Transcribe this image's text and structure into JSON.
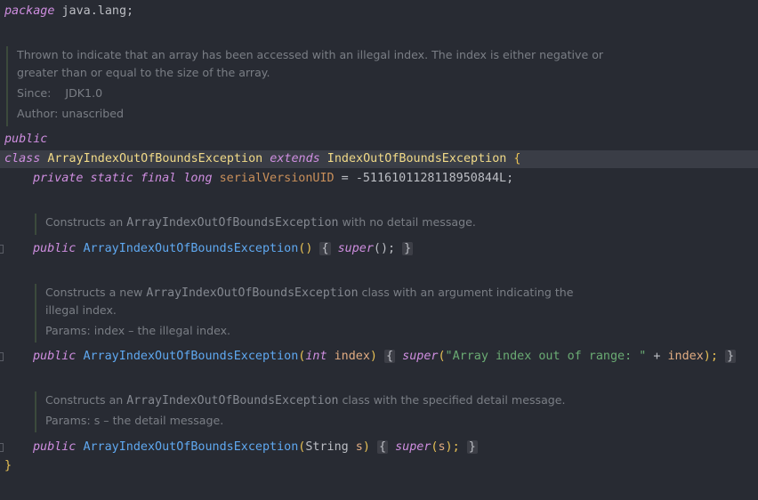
{
  "code": {
    "package_kw": "package",
    "package_name": " java.lang;",
    "class_doc": {
      "line1": "Thrown to indicate that an array has been accessed with an illegal index. The index is either negative or",
      "line2": "greater than or equal to the size of the array.",
      "since_label": "Since:",
      "since_value": "JDK1.0",
      "author": "Author: unascribed"
    },
    "public_kw": "public",
    "class_kw": "class",
    "class_name": "ArrayIndexOutOfBoundsException",
    "extends_kw": "extends",
    "super_class": "IndexOutOfBoundsException",
    "open_brace": "{",
    "field": {
      "private_kw": "private",
      "static_kw": "static",
      "final_kw": "final",
      "long_kw": "long",
      "name": "serialVersionUID",
      "assign": " = ",
      "value": "-5116101128118950844L",
      "semicolon": ";"
    },
    "ctor1_doc": {
      "pre": "Constructs an ",
      "code": "ArrayIndexOutOfBoundsException",
      "post": " with no detail message."
    },
    "ctor1": {
      "public_kw": "public",
      "name": "ArrayIndexOutOfBoundsException",
      "params": "()",
      "open": "{",
      "super_kw": "super",
      "call": "();",
      "close": "}"
    },
    "ctor2_doc": {
      "pre": "Constructs a new ",
      "code": "ArrayIndexOutOfBoundsException",
      "post": " class with an argument indicating the",
      "line2": "illegal index.",
      "params": "Params: index – the illegal index."
    },
    "ctor2": {
      "public_kw": "public",
      "name": "ArrayIndexOutOfBoundsException",
      "paren_open": "(",
      "int_kw": "int",
      "param": "index",
      "paren_close": ")",
      "open": "{",
      "super_kw": "super",
      "call_open": "(",
      "string": "\"Array index out of range: \"",
      "plus": " + ",
      "arg": "index",
      "call_close": ");",
      "close": "}"
    },
    "ctor3_doc": {
      "pre": "Constructs an ",
      "code": "ArrayIndexOutOfBoundsException",
      "post": " class with the specified detail message.",
      "params": "Params: s – the detail message."
    },
    "ctor3": {
      "public_kw": "public",
      "name": "ArrayIndexOutOfBoundsException",
      "paren_open": "(",
      "type": "String",
      "param": "s",
      "paren_close": ")",
      "open": "{",
      "super_kw": "super",
      "call_open": "(",
      "arg": "s",
      "call_close": ");",
      "close": "}"
    },
    "close_brace": "}"
  }
}
